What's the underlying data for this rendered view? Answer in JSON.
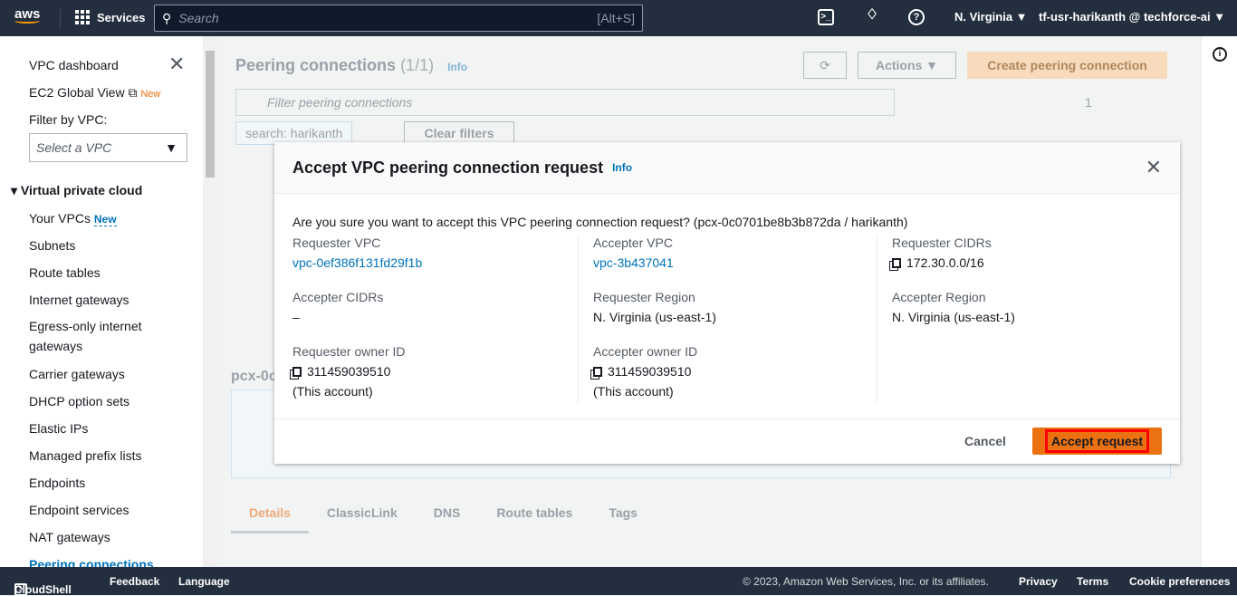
{
  "header": {
    "logo": "aws",
    "services": "Services",
    "search_placeholder": "Search",
    "search_shortcut": "[Alt+S]",
    "region": "N. Virginia ▼",
    "account": "tf-usr-harikanth @ techforce-ai ▼"
  },
  "sidebar": {
    "dashboard": "VPC dashboard",
    "global_view": "EC2 Global View",
    "new_badge": "New",
    "filter_label": "Filter by VPC:",
    "filter_placeholder": "Select a VPC",
    "section": "Virtual private cloud",
    "items": [
      "Your VPCs",
      "Subnets",
      "Route tables",
      "Internet gateways",
      "Egress-only internet gateways",
      "Carrier gateways",
      "DHCP option sets",
      "Elastic IPs",
      "Managed prefix lists",
      "Endpoints",
      "Endpoint services",
      "NAT gateways",
      "Peering connections"
    ]
  },
  "main": {
    "title": "Peering connections",
    "count": "(1/1)",
    "info": "Info",
    "actions": "Actions ▼",
    "create": "Create peering connection",
    "filter_placeholder": "Filter peering connections",
    "page": "1",
    "filter_token": "search: harikanth",
    "clear_filters": "Clear filters",
    "detail_id": "pcx-0c",
    "tabs": [
      "Details",
      "ClassicLink",
      "DNS",
      "Route tables",
      "Tags"
    ]
  },
  "modal": {
    "title": "Accept VPC peering connection request",
    "info": "Info",
    "question": "Are you sure you want to accept this VPC peering connection request? (pcx-0c0701be8b3b872da / harikanth)",
    "fields": {
      "requester_vpc_label": "Requester VPC",
      "requester_vpc": "vpc-0ef386f131fd29f1b",
      "accepter_vpc_label": "Accepter VPC",
      "accepter_vpc": "vpc-3b437041",
      "requester_cidrs_label": "Requester CIDRs",
      "requester_cidrs": "172.30.0.0/16",
      "accepter_cidrs_label": "Accepter CIDRs",
      "accepter_cidrs": "–",
      "requester_region_label": "Requester Region",
      "requester_region": "N. Virginia (us-east-1)",
      "accepter_region_label": "Accepter Region",
      "accepter_region": "N. Virginia (us-east-1)",
      "requester_owner_label": "Requester owner ID",
      "requester_owner": "311459039510",
      "requester_owner_note": "(This account)",
      "accepter_owner_label": "Accepter owner ID",
      "accepter_owner": "311459039510",
      "accepter_owner_note": "(This account)"
    },
    "cancel": "Cancel",
    "accept": "Accept request"
  },
  "footer": {
    "cloudshell": "CloudShell",
    "feedback": "Feedback",
    "language": "Language",
    "copyright": "© 2023, Amazon Web Services, Inc. or its affiliates.",
    "privacy": "Privacy",
    "terms": "Terms",
    "cookies": "Cookie preferences"
  },
  "colors": {
    "accent": "#ec7211",
    "link": "#0073bb",
    "header": "#232f3e"
  }
}
